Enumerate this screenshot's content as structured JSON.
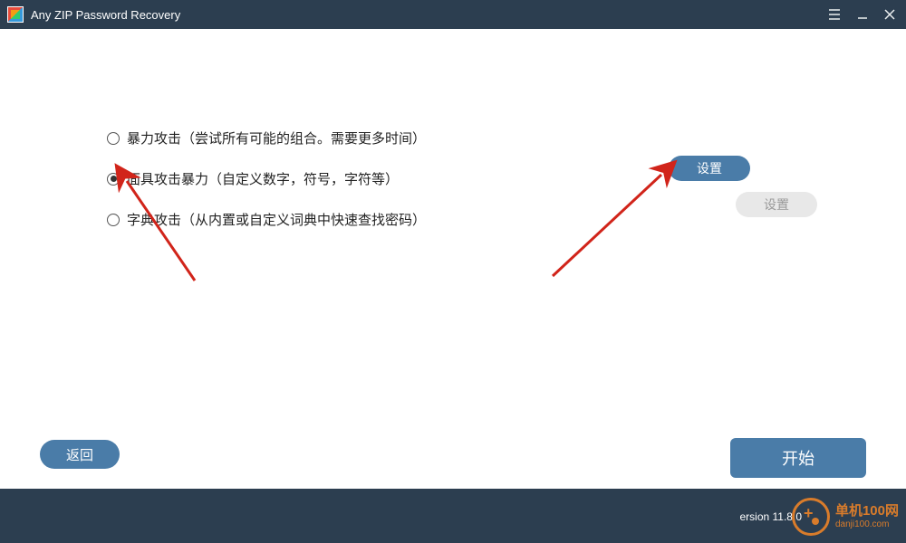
{
  "titlebar": {
    "app_title": "Any ZIP Password Recovery"
  },
  "options": {
    "brute_force": "暴力攻击（尝试所有可能的组合。需要更多时间）",
    "mask_attack": "面具攻击暴力（自定义数字，符号，字符等）",
    "dictionary": "字典攻击（从内置或自定义词典中快速查找密码）",
    "selected": "mask_attack"
  },
  "buttons": {
    "settings": "设置",
    "settings_disabled": "设置",
    "back": "返回",
    "start": "开始"
  },
  "version": "ersion 11.8.0",
  "watermark": {
    "cn": "单机100网",
    "en": "danji100.com"
  }
}
